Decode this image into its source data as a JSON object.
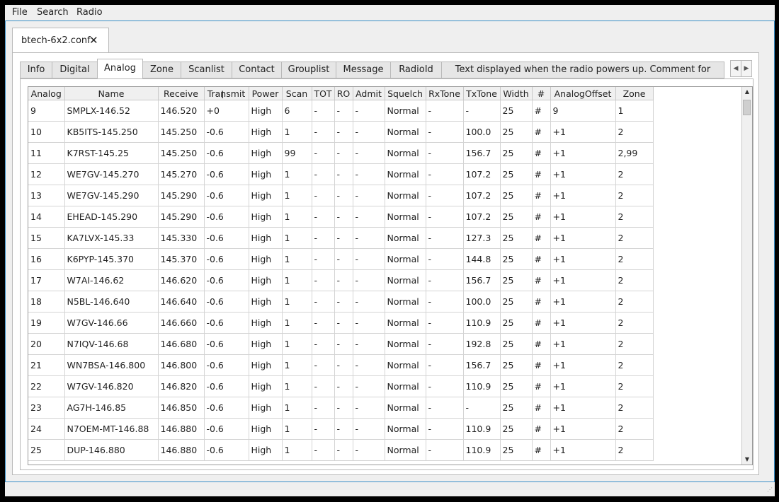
{
  "menu": {
    "file": "File",
    "search": "Search",
    "radio": "Radio"
  },
  "document_tab": {
    "label": "btech-6x2.conf",
    "close_icon": "close-icon"
  },
  "tabs": [
    "Info",
    "Digital",
    "Analog",
    "Zone",
    "Scanlist",
    "Contact",
    "Grouplist",
    "Message",
    "RadioId",
    "Text displayed when the radio powers up. Comment for picture"
  ],
  "active_tab": "Analog",
  "table": {
    "headers": [
      "Analog",
      "Name",
      "Receive",
      "Transmit",
      "Power",
      "Scan",
      "TOT",
      "RO",
      "Admit",
      "Squelch",
      "RxTone",
      "TxTone",
      "Width",
      "#",
      "AnalogOffset",
      "Zone"
    ],
    "rows": [
      [
        "9",
        "SMPLX-146.52",
        "146.520",
        "+0",
        "High",
        "6",
        "-",
        "-",
        "-",
        "Normal",
        "-",
        "-",
        "25",
        "#",
        "9",
        "1"
      ],
      [
        "10",
        "KB5ITS-145.250",
        "145.250",
        "-0.6",
        "High",
        "1",
        "-",
        "-",
        "-",
        "Normal",
        "-",
        "100.0",
        "25",
        "#",
        "+1",
        "2"
      ],
      [
        "11",
        "K7RST-145.25",
        "145.250",
        "-0.6",
        "High",
        "99",
        "-",
        "-",
        "-",
        "Normal",
        "-",
        "156.7",
        "25",
        "#",
        "+1",
        "2,99"
      ],
      [
        "12",
        "WE7GV-145.270",
        "145.270",
        "-0.6",
        "High",
        "1",
        "-",
        "-",
        "-",
        "Normal",
        "-",
        "107.2",
        "25",
        "#",
        "+1",
        "2"
      ],
      [
        "13",
        "WE7GV-145.290",
        "145.290",
        "-0.6",
        "High",
        "1",
        "-",
        "-",
        "-",
        "Normal",
        "-",
        "107.2",
        "25",
        "#",
        "+1",
        "2"
      ],
      [
        "14",
        "EHEAD-145.290",
        "145.290",
        "-0.6",
        "High",
        "1",
        "-",
        "-",
        "-",
        "Normal",
        "-",
        "107.2",
        "25",
        "#",
        "+1",
        "2"
      ],
      [
        "15",
        "KA7LVX-145.33",
        "145.330",
        "-0.6",
        "High",
        "1",
        "-",
        "-",
        "-",
        "Normal",
        "-",
        "127.3",
        "25",
        "#",
        "+1",
        "2"
      ],
      [
        "16",
        "K6PYP-145.370",
        "145.370",
        "-0.6",
        "High",
        "1",
        "-",
        "-",
        "-",
        "Normal",
        "-",
        "144.8",
        "25",
        "#",
        "+1",
        "2"
      ],
      [
        "17",
        "W7AI-146.62",
        "146.620",
        "-0.6",
        "High",
        "1",
        "-",
        "-",
        "-",
        "Normal",
        "-",
        "156.7",
        "25",
        "#",
        "+1",
        "2"
      ],
      [
        "18",
        "N5BL-146.640",
        "146.640",
        "-0.6",
        "High",
        "1",
        "-",
        "-",
        "-",
        "Normal",
        "-",
        "100.0",
        "25",
        "#",
        "+1",
        "2"
      ],
      [
        "19",
        "W7GV-146.66",
        "146.660",
        "-0.6",
        "High",
        "1",
        "-",
        "-",
        "-",
        "Normal",
        "-",
        "110.9",
        "25",
        "#",
        "+1",
        "2"
      ],
      [
        "20",
        "N7IQV-146.68",
        "146.680",
        "-0.6",
        "High",
        "1",
        "-",
        "-",
        "-",
        "Normal",
        "-",
        "192.8",
        "25",
        "#",
        "+1",
        "2"
      ],
      [
        "21",
        "WN7BSA-146.800",
        "146.800",
        "-0.6",
        "High",
        "1",
        "-",
        "-",
        "-",
        "Normal",
        "-",
        "156.7",
        "25",
        "#",
        "+1",
        "2"
      ],
      [
        "22",
        "W7GV-146.820",
        "146.820",
        "-0.6",
        "High",
        "1",
        "-",
        "-",
        "-",
        "Normal",
        "-",
        "110.9",
        "25",
        "#",
        "+1",
        "2"
      ],
      [
        "23",
        "AG7H-146.85",
        "146.850",
        "-0.6",
        "High",
        "1",
        "-",
        "-",
        "-",
        "Normal",
        "-",
        "-",
        "25",
        "#",
        "+1",
        "2"
      ],
      [
        "24",
        "N7OEM-MT-146.88",
        "146.880",
        "-0.6",
        "High",
        "1",
        "-",
        "-",
        "-",
        "Normal",
        "-",
        "110.9",
        "25",
        "#",
        "+1",
        "2"
      ],
      [
        "25",
        "DUP-146.880",
        "146.880",
        "-0.6",
        "High",
        "1",
        "-",
        "-",
        "-",
        "Normal",
        "-",
        "110.9",
        "25",
        "#",
        "+1",
        "2"
      ]
    ]
  },
  "icons": {
    "tab_scroll_left": "chevron-left-icon",
    "tab_scroll_right": "chevron-right-icon",
    "scroll_up": "arrow-up-icon",
    "scroll_down": "arrow-down-icon",
    "cursor": "text-cursor-icon"
  },
  "colors": {
    "accent_border": "#3a8fc7"
  }
}
